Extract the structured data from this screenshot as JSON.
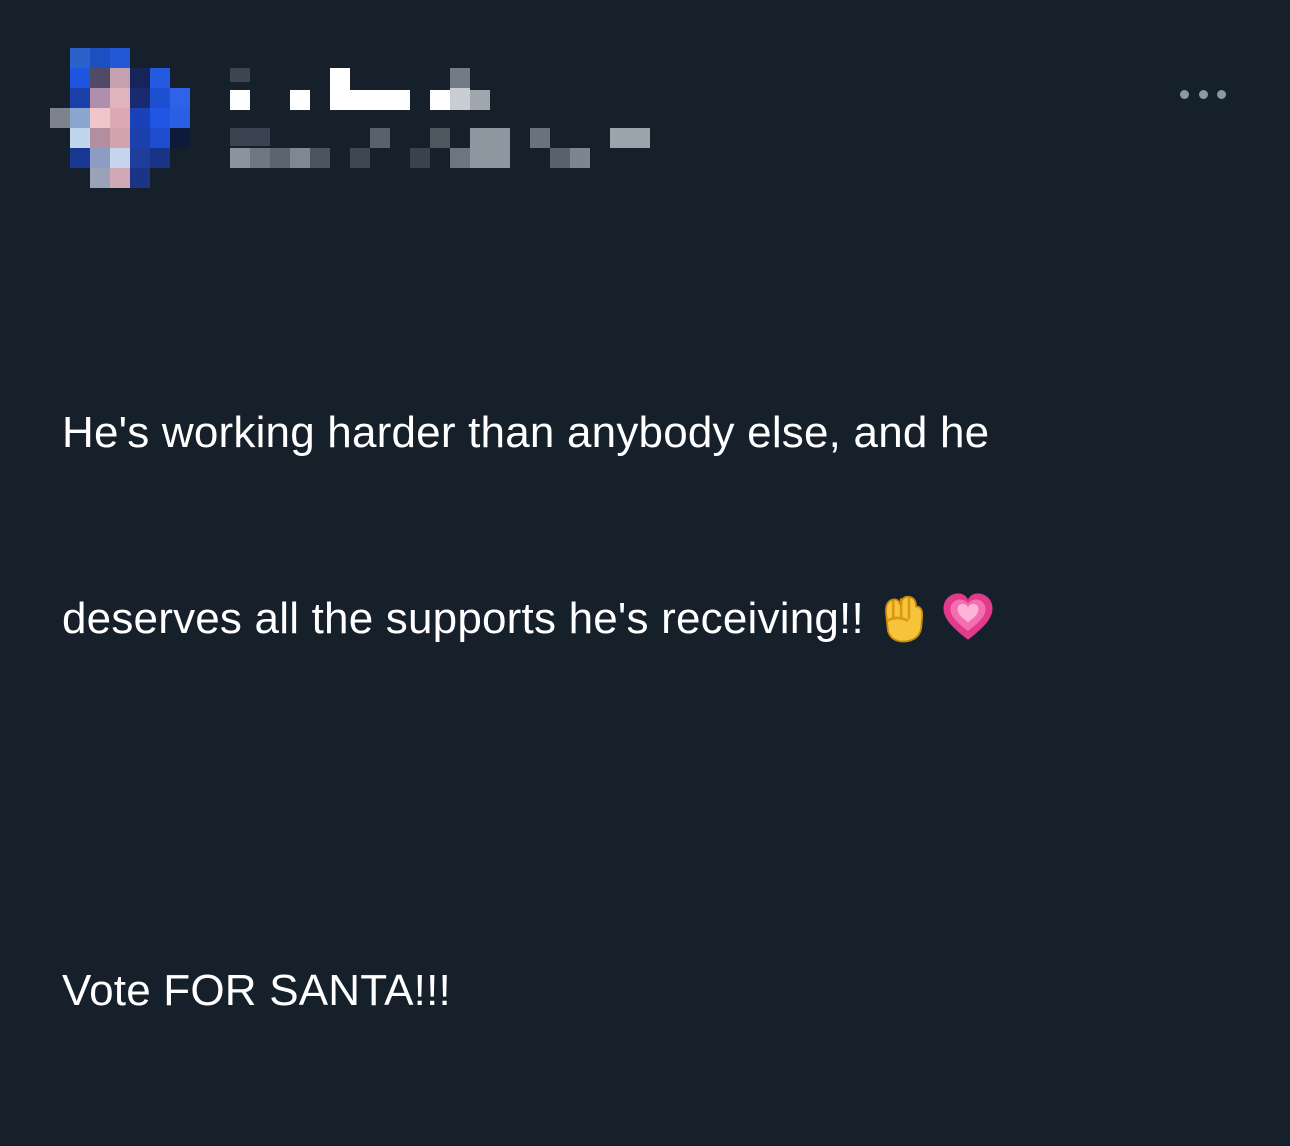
{
  "post": {
    "author": {
      "avatar_icon": "pixelated-avatar-icon",
      "name": "",
      "handle": ""
    },
    "more_icon": "more-options-icon",
    "text_lines": [
      "He's working harder than anybody else, and he",
      "deserves all the supports he's receiving!!",
      "",
      "Vote FOR SANTA!!!"
    ],
    "emojis": [
      "raised-fist-emoji",
      "growing-heart-emoji"
    ]
  },
  "colors": {
    "background": "#15202b",
    "text": "#ffffff",
    "icon_gray": "#8b98a5"
  }
}
